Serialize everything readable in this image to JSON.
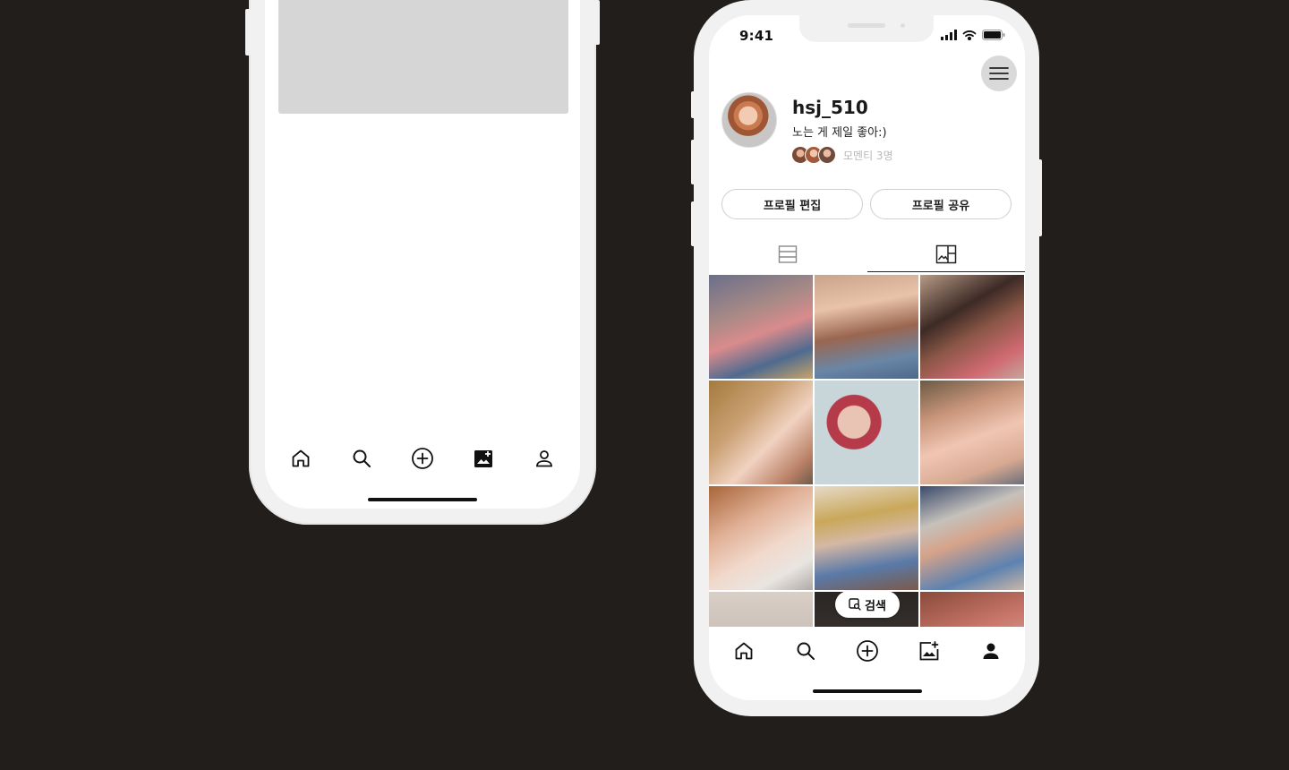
{
  "left_phone": {
    "tabbar": [
      "home-icon",
      "search-icon",
      "add-icon",
      "gallery-add-icon",
      "profile-icon"
    ]
  },
  "right_phone": {
    "status_bar": {
      "time": "9:41"
    },
    "profile": {
      "username": "hsj_510",
      "bio": "노는 게 제일 좋아:)",
      "moments_label": "모멘티 3명"
    },
    "buttons": {
      "edit_profile": "프로필 편집",
      "share_profile": "프로필 공유"
    },
    "view_tabs": [
      "list-view-icon",
      "gallery-view-icon"
    ],
    "active_view_tab": 1,
    "search_chip": {
      "label": "검색"
    },
    "tabbar": [
      "home-icon",
      "search-icon",
      "add-icon",
      "gallery-add-icon",
      "profile-icon"
    ],
    "active_tab": 4
  },
  "colors": {
    "background": "#221e1b",
    "phone_frame": "#f1f1f1",
    "placeholder": "#d6d6d6",
    "menu_button": "#d9d9d9"
  }
}
